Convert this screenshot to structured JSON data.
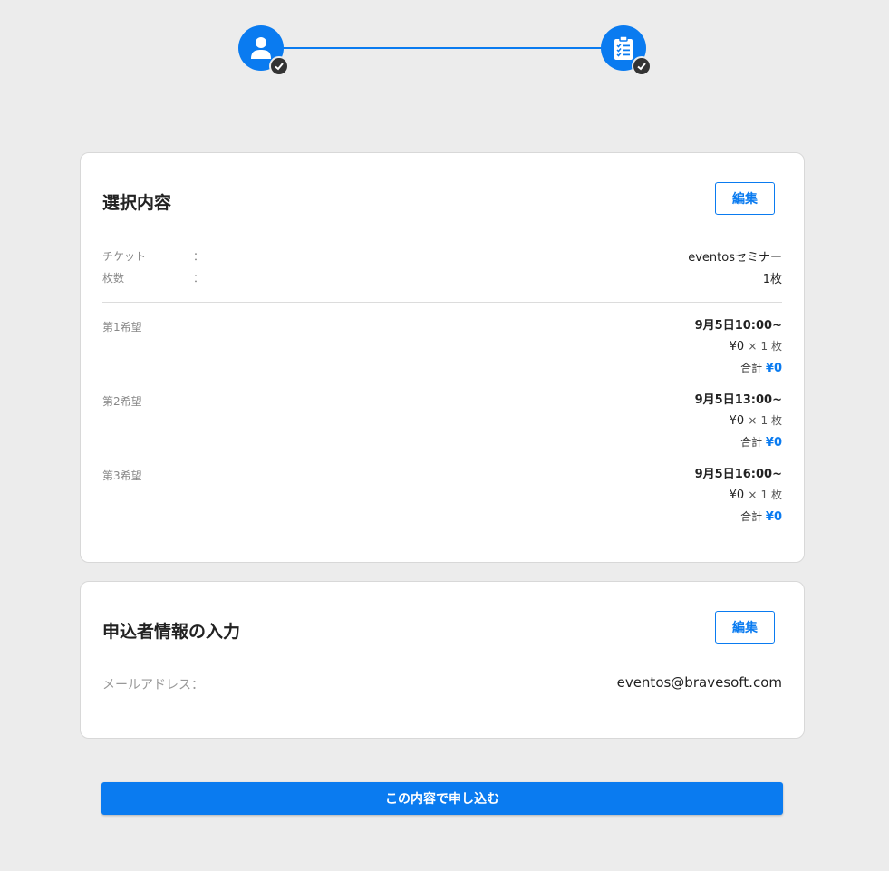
{
  "stepper": {
    "steps": [
      {
        "icon": "user-icon",
        "status": "completed"
      },
      {
        "icon": "clipboard-icon",
        "status": "completed"
      }
    ]
  },
  "selection": {
    "title": "選択内容",
    "edit_label": "編集",
    "ticket_label": "チケット",
    "ticket_value": "eventosセミナー",
    "count_label": "枚数",
    "count_value": "1枚",
    "colon": "：",
    "preferences": [
      {
        "label": "第1希望",
        "time": "9月5日10:00~",
        "price": "¥0",
        "multiplier": "×",
        "qty": "1 枚",
        "total_label": "合計",
        "total": "¥0"
      },
      {
        "label": "第2希望",
        "time": "9月5日13:00~",
        "price": "¥0",
        "multiplier": "×",
        "qty": "1 枚",
        "total_label": "合計",
        "total": "¥0"
      },
      {
        "label": "第3希望",
        "time": "9月5日16:00~",
        "price": "¥0",
        "multiplier": "×",
        "qty": "1 枚",
        "total_label": "合計",
        "total": "¥0"
      }
    ]
  },
  "applicant": {
    "title": "申込者情報の入力",
    "edit_label": "編集",
    "email_label": "メールアドレス：",
    "email_value": "eventos@bravesoft.com"
  },
  "submit_label": "この内容で申し込む",
  "colors": {
    "accent": "#0a7bf0",
    "background": "#ececec",
    "check": "#333333"
  }
}
